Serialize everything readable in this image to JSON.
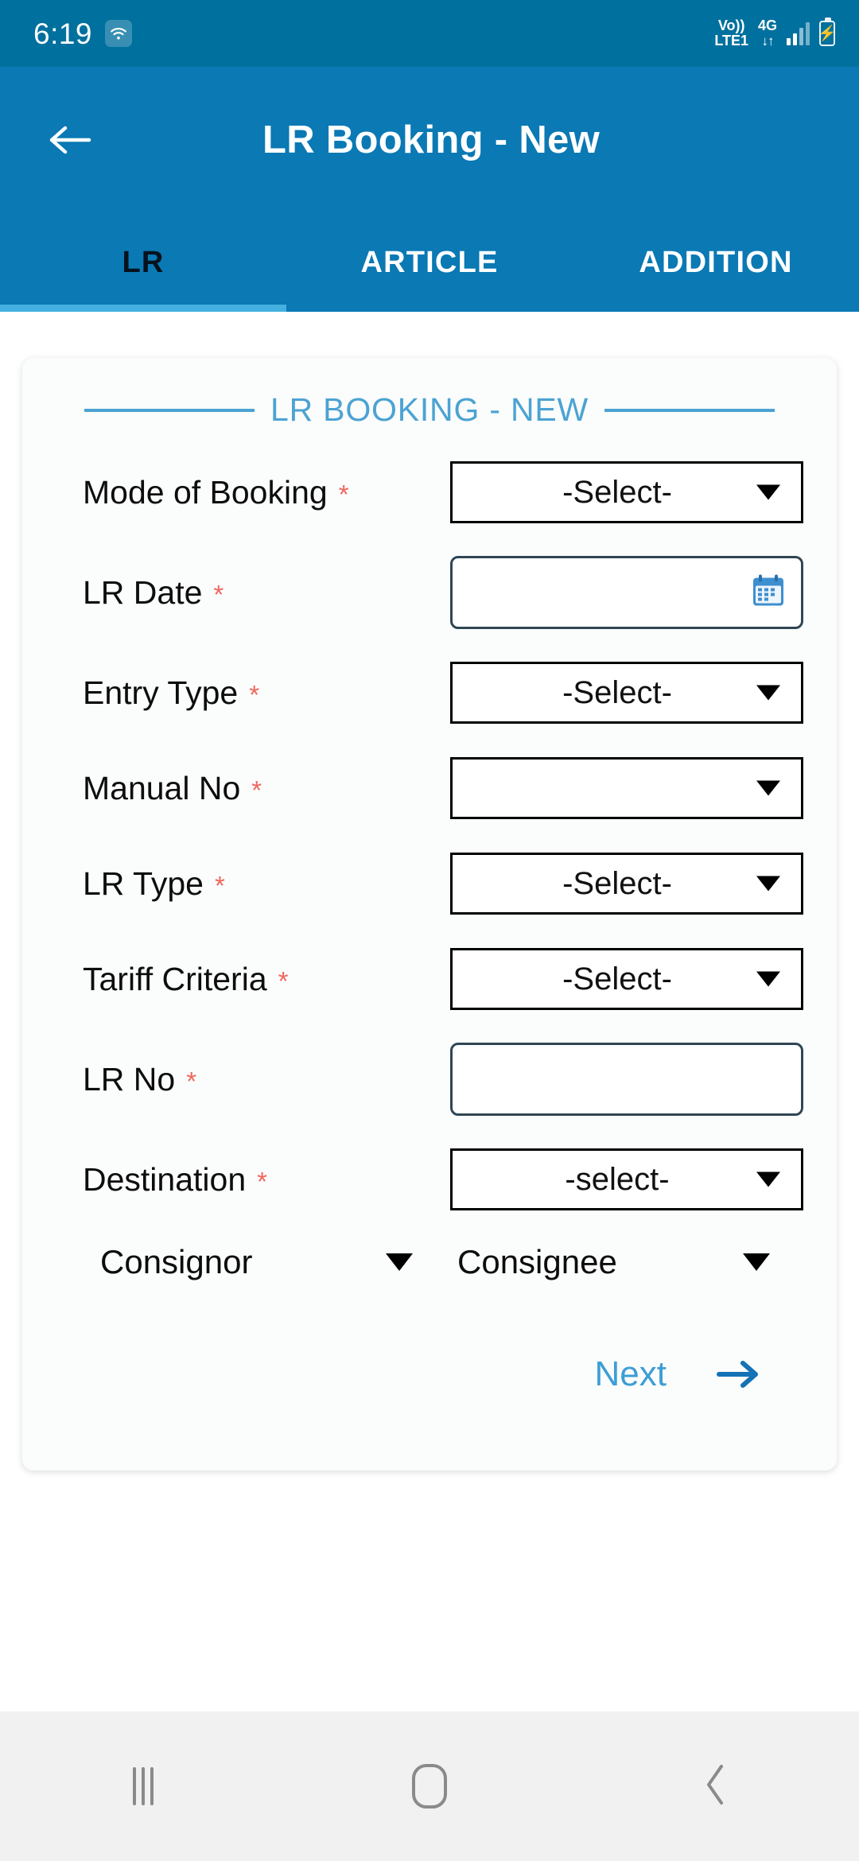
{
  "status_bar": {
    "time": "6:19",
    "wifi_icon": "wifi-icon",
    "volte_top": "Vo))",
    "volte_bottom": "LTE1",
    "network": "4G",
    "data_arrows": "↓↑",
    "battery_state": "charging"
  },
  "app_bar": {
    "back_icon": "back-arrow-icon",
    "title": "LR Booking - New",
    "tabs": [
      {
        "label": "LR",
        "active": true
      },
      {
        "label": "ARTICLE",
        "active": false
      },
      {
        "label": "ADDITION",
        "active": false
      }
    ]
  },
  "card": {
    "title": "LR BOOKING - NEW",
    "fields": [
      {
        "label": "Mode of Booking",
        "required": "*",
        "type": "select",
        "value": "-Select-"
      },
      {
        "label": "LR Date",
        "required": "*",
        "type": "date",
        "value": "",
        "icon": "calendar-icon"
      },
      {
        "label": "Entry Type",
        "required": "*",
        "type": "select",
        "value": "-Select-"
      },
      {
        "label": "Manual No",
        "required": "*",
        "type": "select",
        "value": ""
      },
      {
        "label": "LR Type",
        "required": "*",
        "type": "select",
        "value": "-Select-"
      },
      {
        "label": "Tariff Criteria",
        "required": "*",
        "type": "select",
        "value": "-Select-"
      },
      {
        "label": "LR No",
        "required": "*",
        "type": "text",
        "value": ""
      },
      {
        "label": "Destination",
        "required": "*",
        "type": "select",
        "value": "-select-"
      }
    ],
    "expanders": [
      {
        "label": "Consignor"
      },
      {
        "label": "Consignee"
      }
    ],
    "next": {
      "label": "Next",
      "icon": "arrow-right-icon"
    }
  },
  "nav_bar": {
    "recents": "recents-icon",
    "home": "home-icon",
    "back": "back-icon"
  },
  "colors": {
    "status_bar": "#00709e",
    "app_bar": "#0a79b4",
    "tab_indicator": "#44b0e0",
    "card_title": "#4ba3d3",
    "required_asterisk": "#f0665c",
    "next_link": "#3d9ed6",
    "next_arrow": "#1472b5",
    "input_border": "#2f4654"
  }
}
